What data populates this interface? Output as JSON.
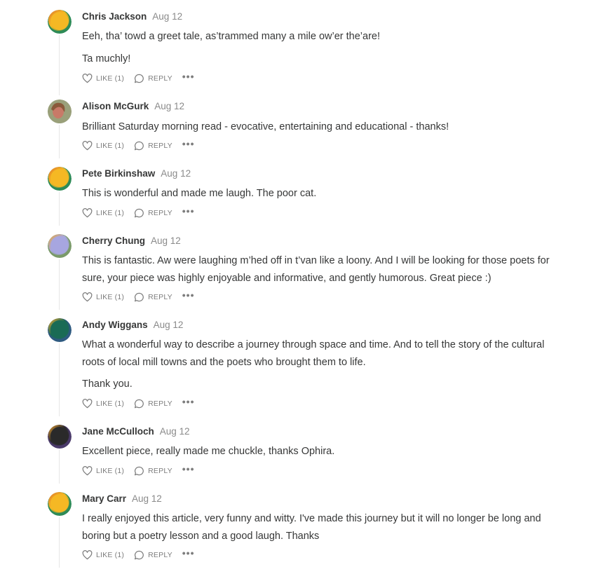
{
  "comments": [
    {
      "author": "Chris Jackson",
      "date": "Aug 12",
      "avatar": {
        "kind": "gradient",
        "main": "#f5b824",
        "accent": "#e07a2a",
        "edge": "#2e8b57"
      },
      "paragraphs": [
        "Eeh, tha’ towd a greet tale, as’trammed many a mile ow’er the’are!",
        "Ta muchly!"
      ],
      "like_label": "LIKE (1)",
      "reply_label": "REPLY",
      "more_label": "•••"
    },
    {
      "author": "Alison McGurk",
      "date": "Aug 12",
      "avatar": {
        "kind": "photo",
        "main": "#9aa07a",
        "accent": "#c87a68",
        "edge": "#6f7b5c"
      },
      "paragraphs": [
        "Brilliant Saturday morning read - evocative, entertaining and educational - thanks!"
      ],
      "like_label": "LIKE (1)",
      "reply_label": "REPLY",
      "more_label": "•••"
    },
    {
      "author": "Pete Birkinshaw",
      "date": "Aug 12",
      "avatar": {
        "kind": "gradient",
        "main": "#f5b824",
        "accent": "#e07a2a",
        "edge": "#2e8b57"
      },
      "paragraphs": [
        "This is wonderful and made me laugh. The poor cat."
      ],
      "like_label": "LIKE (1)",
      "reply_label": "REPLY",
      "more_label": "•••"
    },
    {
      "author": "Cherry Chung",
      "date": "Aug 12",
      "avatar": {
        "kind": "gradient",
        "main": "#a7a6e0",
        "accent": "#e6a83a",
        "edge": "#7a9a6a"
      },
      "paragraphs": [
        "This is fantastic. Aw were laughing m’hed off in t’van like a loony. And I will be looking for those poets for sure, your piece was highly enjoyable and informative, and gently humorous. Great piece :)"
      ],
      "like_label": "LIKE (1)",
      "reply_label": "REPLY",
      "more_label": "•••"
    },
    {
      "author": "Andy Wiggans",
      "date": "Aug 12",
      "avatar": {
        "kind": "gradient",
        "main": "#1a6b55",
        "accent": "#f0a830",
        "edge": "#2e5a80"
      },
      "paragraphs": [
        "What a wonderful way to describe a journey through space and time. And to tell the story of the cultural roots of local mill towns and the poets who brought them to life.",
        "Thank you."
      ],
      "like_label": "LIKE (1)",
      "reply_label": "REPLY",
      "more_label": "•••"
    },
    {
      "author": "Jane McCulloch",
      "date": "Aug 12",
      "avatar": {
        "kind": "gradient",
        "main": "#2a2a2a",
        "accent": "#e8a030",
        "edge": "#4a3a6a"
      },
      "paragraphs": [
        "Excellent piece, really made me chuckle, thanks Ophira."
      ],
      "like_label": "LIKE (1)",
      "reply_label": "REPLY",
      "more_label": "•••"
    },
    {
      "author": "Mary Carr",
      "date": "Aug 12",
      "avatar": {
        "kind": "gradient",
        "main": "#f5b824",
        "accent": "#e07a2a",
        "edge": "#2e8b57"
      },
      "paragraphs": [
        "I really enjoyed this article, very funny and witty. I've made this journey but it will no longer be long and boring but a poetry lesson and a good laugh. Thanks"
      ],
      "like_label": "LIKE (1)",
      "reply_label": "REPLY",
      "more_label": "•••"
    }
  ],
  "icons": {
    "like": "heart-icon",
    "reply": "speech-bubble-icon",
    "more": "ellipsis-icon"
  }
}
